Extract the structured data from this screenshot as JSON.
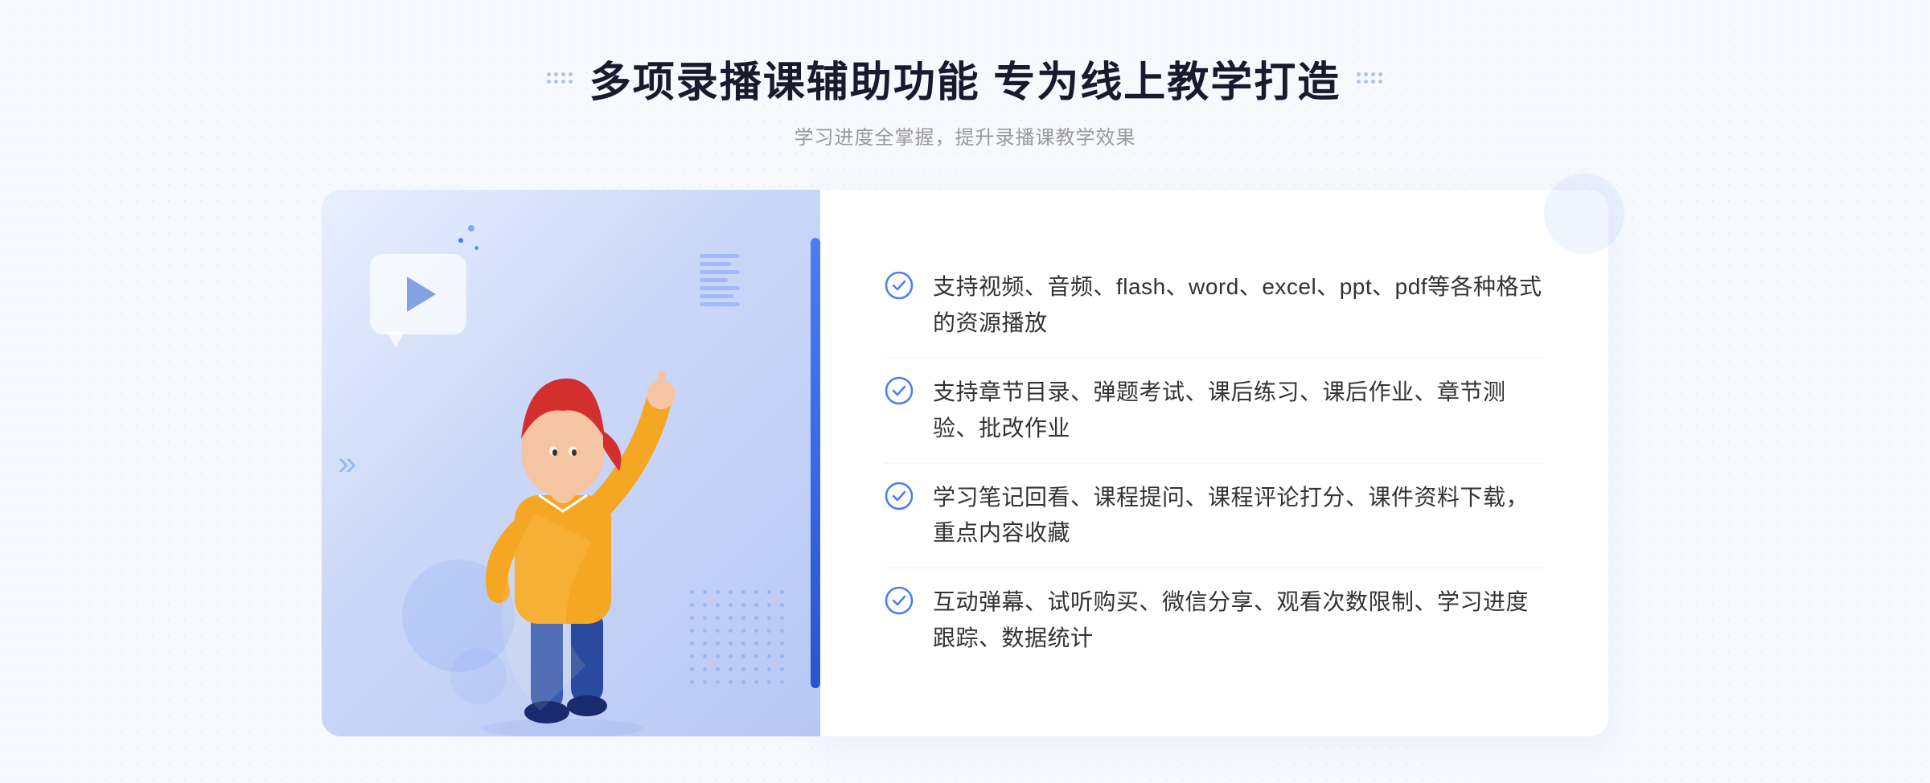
{
  "header": {
    "title": "多项录播课辅助功能 专为线上教学打造",
    "subtitle": "学习进度全掌握，提升录播课教学效果"
  },
  "features": [
    {
      "id": 1,
      "text": "支持视频、音频、flash、word、excel、ppt、pdf等各种格式的资源播放"
    },
    {
      "id": 2,
      "text": "支持章节目录、弹题考试、课后练习、课后作业、章节测验、批改作业"
    },
    {
      "id": 3,
      "text": "学习笔记回看、课程提问、课程评论打分、课件资料下载，重点内容收藏"
    },
    {
      "id": 4,
      "text": "互动弹幕、试听购买、微信分享、观看次数限制、学习进度跟踪、数据统计"
    }
  ],
  "icons": {
    "check_color": "#4a7cf5",
    "decorator_color": "#b0c4e8"
  }
}
